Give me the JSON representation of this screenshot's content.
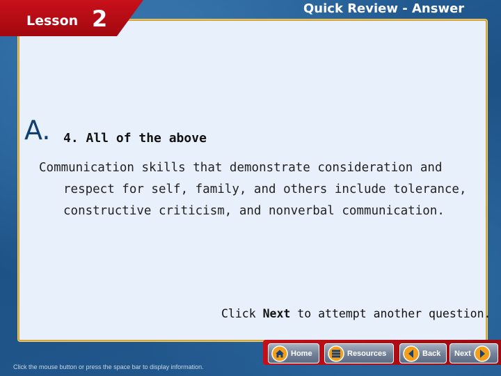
{
  "header": {
    "lesson_label": "Lesson",
    "lesson_number": "2",
    "title": "Quick Review - Answer"
  },
  "answer": {
    "letter": "A.",
    "text": "4. All of the above"
  },
  "explanation": "Communication skills that demonstrate consideration and respect for self, family, and others include tolerance, constructive criticism, and nonverbal communication.",
  "next_prompt": {
    "prefix": "Click ",
    "bold": "Next",
    "suffix": " to attempt another question."
  },
  "footer_hint": "Click the mouse button or press the space bar to display information.",
  "nav": {
    "home": "Home",
    "resources": "Resources",
    "back": "Back",
    "next": "Next"
  },
  "colors": {
    "accent_red": "#c40f18",
    "panel_bg": "#e8f1fb",
    "panel_border": "#d8a73a",
    "background_blue": "#1d5286",
    "nav_icon_orange": "#f2a01b"
  }
}
